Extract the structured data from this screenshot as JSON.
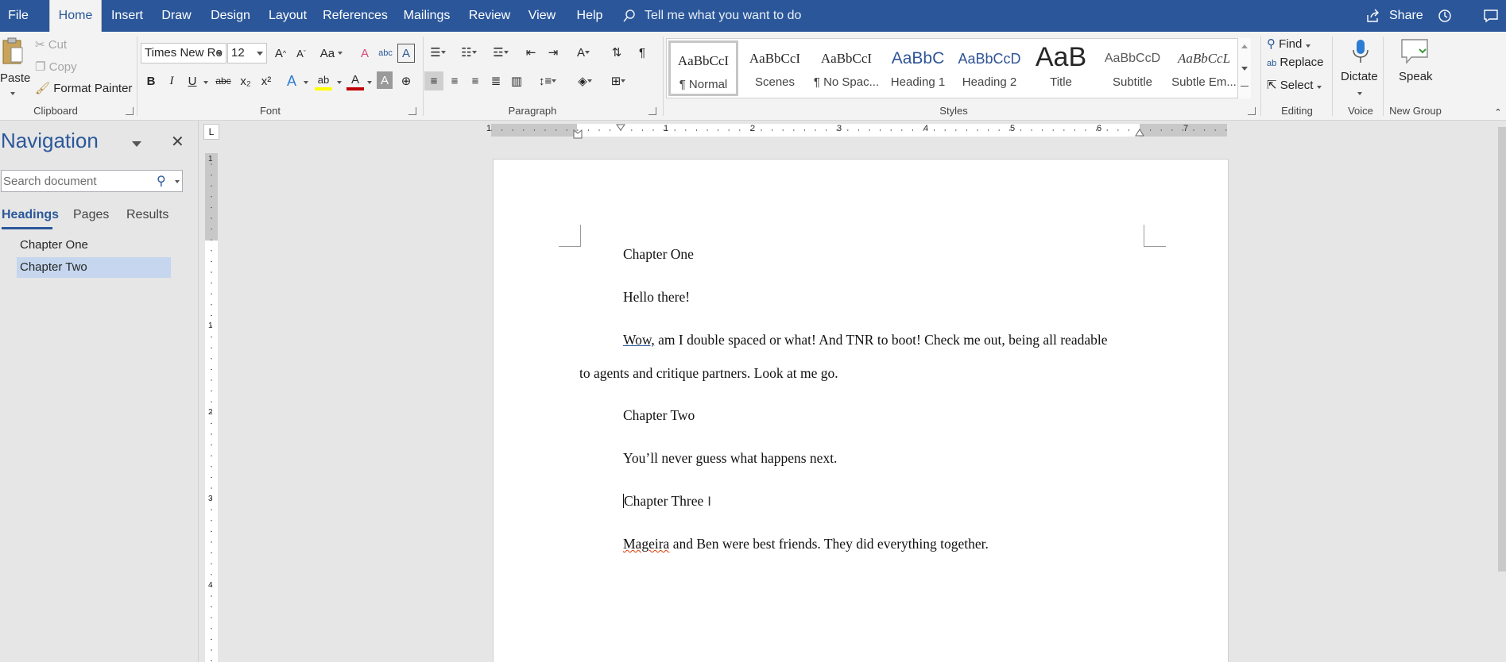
{
  "menu": {
    "tabs": [
      {
        "label": "File"
      },
      {
        "label": "Home"
      },
      {
        "label": "Insert"
      },
      {
        "label": "Draw"
      },
      {
        "label": "Design"
      },
      {
        "label": "Layout"
      },
      {
        "label": "References"
      },
      {
        "label": "Mailings"
      },
      {
        "label": "Review"
      },
      {
        "label": "View"
      },
      {
        "label": "Help"
      }
    ],
    "active": "Home",
    "tell_me": "Tell me what you want to do",
    "share": "Share"
  },
  "ribbon": {
    "clipboard": {
      "paste": "Paste",
      "cut": "Cut",
      "copy": "Copy",
      "format_painter": "Format Painter",
      "label": "Clipboard"
    },
    "font": {
      "font_name": "Times New Ro",
      "font_size": "12",
      "change_case": "Aa",
      "bold": "B",
      "italic": "I",
      "underline": "U",
      "strike": "abc",
      "subscript": "x₂",
      "superscript": "x²",
      "label": "Font"
    },
    "paragraph": {
      "label": "Paragraph"
    },
    "styles": {
      "items": [
        {
          "sample": "AaBbCcI",
          "name": "¶ Normal"
        },
        {
          "sample": "AaBbCcI",
          "name": "Scenes"
        },
        {
          "sample": "AaBbCcI",
          "name": "¶ No Spac..."
        },
        {
          "sample": "AaBbC",
          "name": "Heading 1"
        },
        {
          "sample": "AaBbCcD",
          "name": "Heading 2"
        },
        {
          "sample": "AaB",
          "name": "Title"
        },
        {
          "sample": "AaBbCcD",
          "name": "Subtitle"
        },
        {
          "sample": "AaBbCcL",
          "name": "Subtle Em..."
        }
      ],
      "label": "Styles"
    },
    "editing": {
      "find": "Find",
      "replace": "Replace",
      "select": "Select",
      "label": "Editing"
    },
    "voice": {
      "dictate": "Dictate",
      "label": "Voice"
    },
    "new_group": {
      "speak": "Speak",
      "label": "New Group"
    }
  },
  "navigation": {
    "title": "Navigation",
    "search_placeholder": "Search document",
    "tabs": [
      "Headings",
      "Pages",
      "Results"
    ],
    "headings": [
      "Chapter One",
      "Chapter Two"
    ],
    "selected_heading": "Chapter Two"
  },
  "ruler": {
    "h_labels": [
      "1",
      "1",
      "2",
      "3",
      "4",
      "5",
      "6",
      "7"
    ],
    "v_labels": [
      "1",
      "1",
      "2",
      "3",
      "4"
    ],
    "tab_marker": "L"
  },
  "document": {
    "lines": {
      "l1": "Chapter One",
      "l2": "Hello there!",
      "l3_first": "Wow,",
      "l3_rest": " am I double spaced or what! And TNR to boot! Check me out, being all readable",
      "l4": "to agents and critique partners. Look at me go.",
      "l5": "Chapter Two",
      "l6": "You’ll never guess what happens next.",
      "l7": "Chapter Three",
      "l8_first": "Mageira",
      "l8_rest": " and Ben were best friends. They did everything together."
    }
  },
  "colors": {
    "brand": "#2b579a",
    "ribbon": "#f3f3f3",
    "nav_selected": "#c5d6ee"
  }
}
